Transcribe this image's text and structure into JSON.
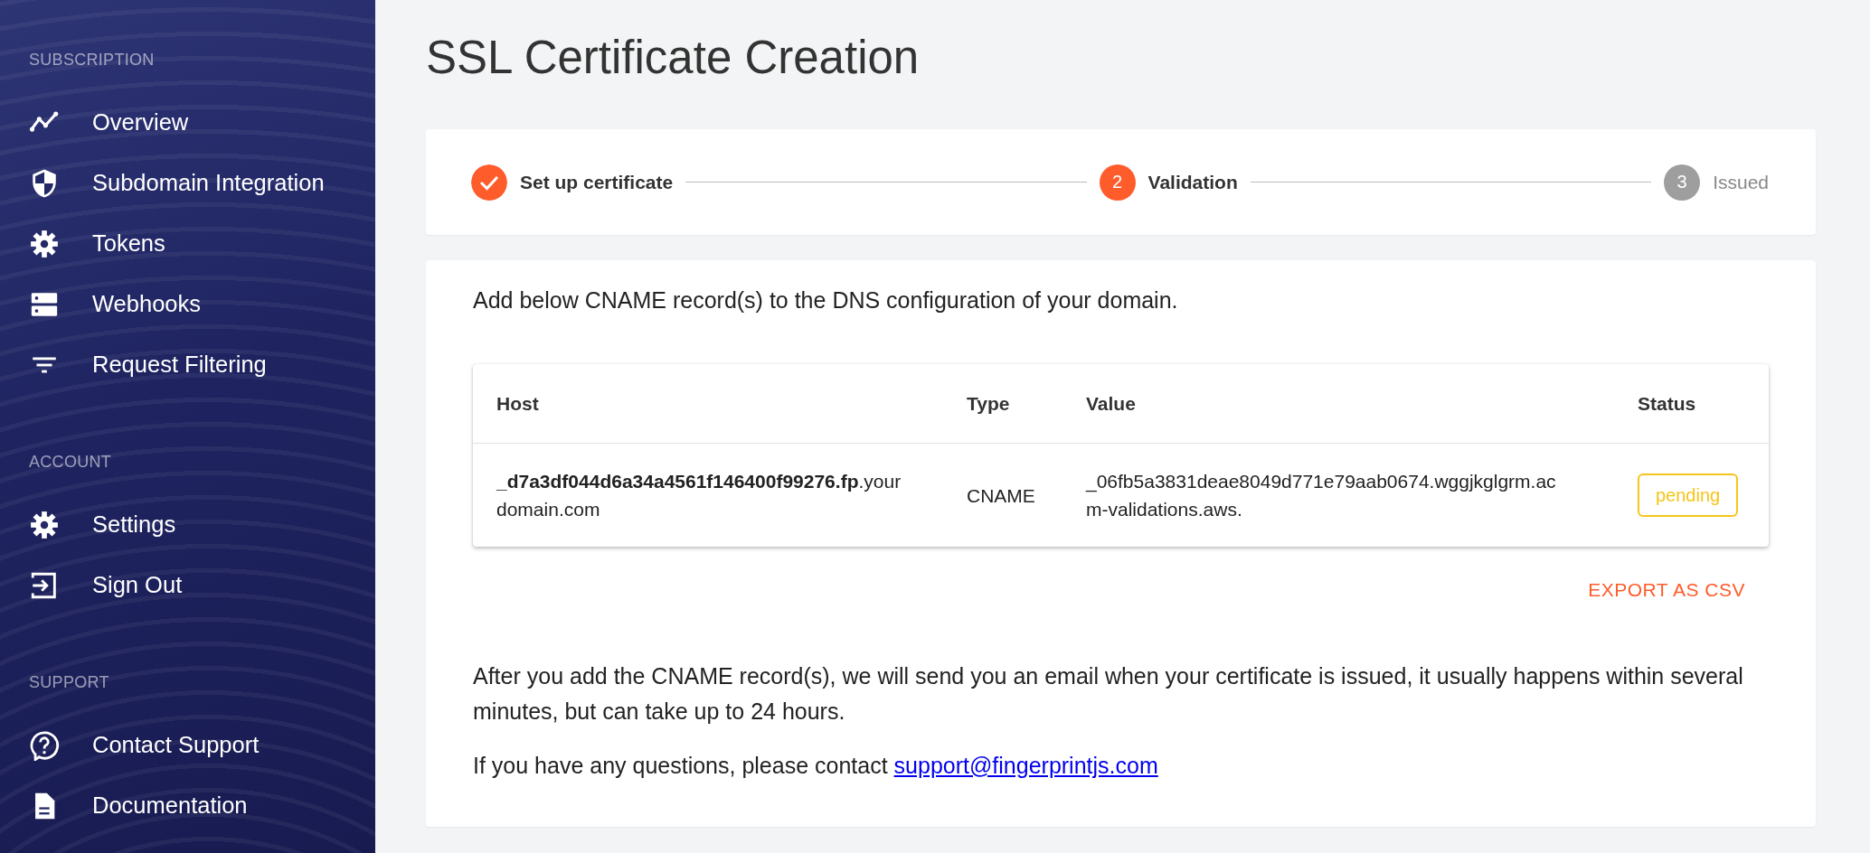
{
  "sidebar": {
    "sections": [
      {
        "heading": "SUBSCRIPTION",
        "items": [
          {
            "label": "Overview",
            "kind": "chart"
          },
          {
            "label": "Subdomain Integration",
            "kind": "shield"
          },
          {
            "label": "Tokens",
            "kind": "gear"
          },
          {
            "label": "Webhooks",
            "kind": "server"
          },
          {
            "label": "Request Filtering",
            "kind": "filter"
          }
        ]
      },
      {
        "heading": "ACCOUNT",
        "items": [
          {
            "label": "Settings",
            "kind": "gear"
          },
          {
            "label": "Sign Out",
            "kind": "exit"
          }
        ]
      },
      {
        "heading": "SUPPORT",
        "items": [
          {
            "label": "Contact Support",
            "kind": "help"
          },
          {
            "label": "Documentation",
            "kind": "doc"
          }
        ]
      }
    ]
  },
  "page": {
    "title": "SSL Certificate Creation"
  },
  "stepper": [
    {
      "label": "Set up certificate",
      "kind": "done"
    },
    {
      "label": "Validation",
      "kind": "active",
      "number": "2"
    },
    {
      "label": "Issued",
      "kind": "pending",
      "number": "3"
    }
  ],
  "intro": "Add below CNAME record(s) to the DNS configuration of your domain.",
  "table": {
    "columns": [
      "Host",
      "Type",
      "Value",
      "Status"
    ],
    "rows": [
      {
        "host": "**_d7a3df044d6a34a4561f146400f99276.fp**.yourdomain.com",
        "type": "CNAME",
        "value": "_06fb5a3831deae8049d771e79aab0674.wggjkglgrm.acm-validations.aws.",
        "status": "pending"
      }
    ]
  },
  "export_button": "EXPORT AS CSV",
  "note": "After you add the CNAME record(s), we will send you an email when your certificate is issued, it usually happens within several minutes, but can take up to 24 hours.",
  "contact": {
    "text": "If you have any questions, please contact",
    "link": "support@fingerprintjs.com"
  }
}
